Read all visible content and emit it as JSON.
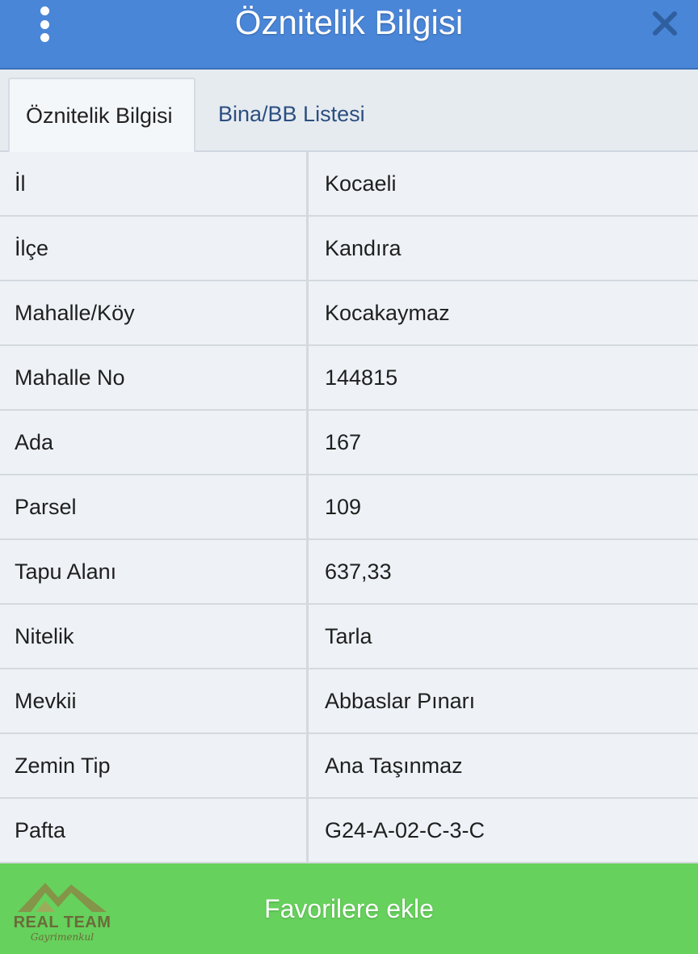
{
  "header": {
    "title": "Öznitelik Bilgisi",
    "menu_icon": "kebab-menu-icon",
    "close_icon": "close-icon",
    "color": "#4a86d8"
  },
  "tabs": [
    {
      "label": "Öznitelik Bilgisi",
      "active": true
    },
    {
      "label": "Bina/BB Listesi",
      "active": false
    }
  ],
  "attributes": [
    {
      "label": "İl",
      "value": "Kocaeli"
    },
    {
      "label": "İlçe",
      "value": "Kandıra"
    },
    {
      "label": "Mahalle/Köy",
      "value": "Kocakaymaz"
    },
    {
      "label": "Mahalle No",
      "value": "144815"
    },
    {
      "label": "Ada",
      "value": "167"
    },
    {
      "label": "Parsel",
      "value": "109"
    },
    {
      "label": "Tapu Alanı",
      "value": "637,33"
    },
    {
      "label": "Nitelik",
      "value": "Tarla"
    },
    {
      "label": "Mevkii",
      "value": "Abbaslar Pınarı"
    },
    {
      "label": "Zemin Tip",
      "value": "Ana Taşınmaz"
    },
    {
      "label": "Pafta",
      "value": "G24-A-02-C-3-C"
    }
  ],
  "footer": {
    "favorite_label": "Favorilere ekle",
    "color": "#66d15c"
  },
  "logo": {
    "name": "REAL TEAM",
    "tagline": "Gayrimenkul"
  }
}
